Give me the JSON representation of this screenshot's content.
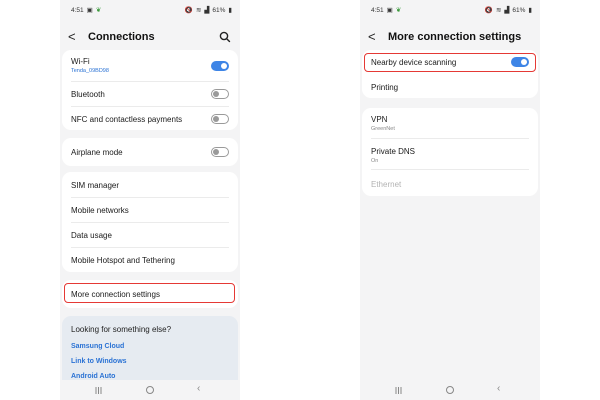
{
  "status_bar": {
    "time": "4:51",
    "battery": "61%"
  },
  "left": {
    "title": "Connections",
    "wifi": {
      "label": "Wi-Fi",
      "network": "Tenda_09BD98",
      "toggle": "on"
    },
    "bluetooth": {
      "label": "Bluetooth",
      "toggle": "off"
    },
    "nfc": {
      "label": "NFC and contactless payments",
      "toggle": "off"
    },
    "airplane": {
      "label": "Airplane mode",
      "toggle": "off"
    },
    "sim_manager": "SIM manager",
    "mobile_networks": "Mobile networks",
    "data_usage": "Data usage",
    "hotspot": "Mobile Hotspot and Tethering",
    "more_settings": "More connection settings",
    "help": {
      "title": "Looking for something else?",
      "links": [
        "Samsung Cloud",
        "Link to Windows",
        "Android Auto"
      ]
    }
  },
  "right": {
    "title": "More connection settings",
    "nearby": {
      "label": "Nearby device scanning",
      "toggle": "on"
    },
    "printing": "Printing",
    "vpn": {
      "label": "VPN",
      "sub": "GreenNet"
    },
    "private_dns": {
      "label": "Private DNS",
      "sub": "On"
    },
    "ethernet": "Ethernet"
  },
  "colors": {
    "accent": "#3e85e6",
    "highlight": "#e53935",
    "link": "#2a72d4"
  },
  "icons": [
    "back-icon",
    "search-icon",
    "recent-apps-icon",
    "home-icon",
    "nav-back-icon"
  ]
}
